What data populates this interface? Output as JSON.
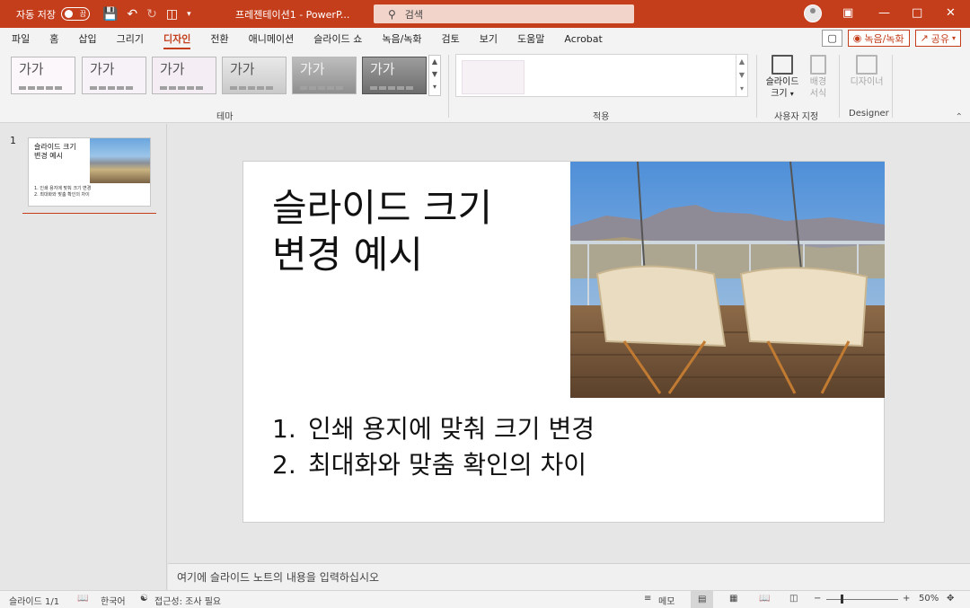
{
  "titlebar": {
    "autosave_label": "자동 저장",
    "autosave_state": "끔",
    "doc_title": "프레젠테이션1  -  PowerP...",
    "search_placeholder": "검색"
  },
  "tabs": [
    "파일",
    "홈",
    "삽입",
    "그리기",
    "디자인",
    "전환",
    "애니메이션",
    "슬라이드 쇼",
    "녹음/녹화",
    "검토",
    "보기",
    "도움말",
    "Acrobat"
  ],
  "active_tab": "디자인",
  "tab_actions": {
    "record": "녹음/녹화",
    "share": "공유"
  },
  "ribbon": {
    "theme_sample_text": "가가",
    "group_theme": "테마",
    "group_variants": "적용",
    "slide_size_label": "슬라이드\n크기",
    "format_bg_label": "배경\n서식",
    "group_customize": "사용자 지정",
    "designer_label": "디자이너",
    "group_designer": "Designer"
  },
  "thumbnails": [
    {
      "number": "1",
      "title": "슬라이드 크기\n변경 예시",
      "items": [
        "1.  인쇄 용지에 맞춰 크기 변경",
        "2.  최대화와 맞춤 확인의 차이"
      ]
    }
  ],
  "slide": {
    "title": "슬라이드 크기\n변경 예시",
    "list": [
      {
        "n": "1.",
        "text": "인쇄 용지에 맞춰 크기 변경"
      },
      {
        "n": "2.",
        "text": "최대화와 맞춤 확인의 차이"
      }
    ]
  },
  "notes_placeholder": "여기에 슬라이드 노트의 내용을 입력하십시오",
  "statusbar": {
    "slide_count": "슬라이드 1/1",
    "language": "한국어",
    "accessibility": "접근성: 조사 필요",
    "notes_btn": "메모",
    "zoom": "50%"
  },
  "colors": {
    "accent": "#c43e1c"
  }
}
